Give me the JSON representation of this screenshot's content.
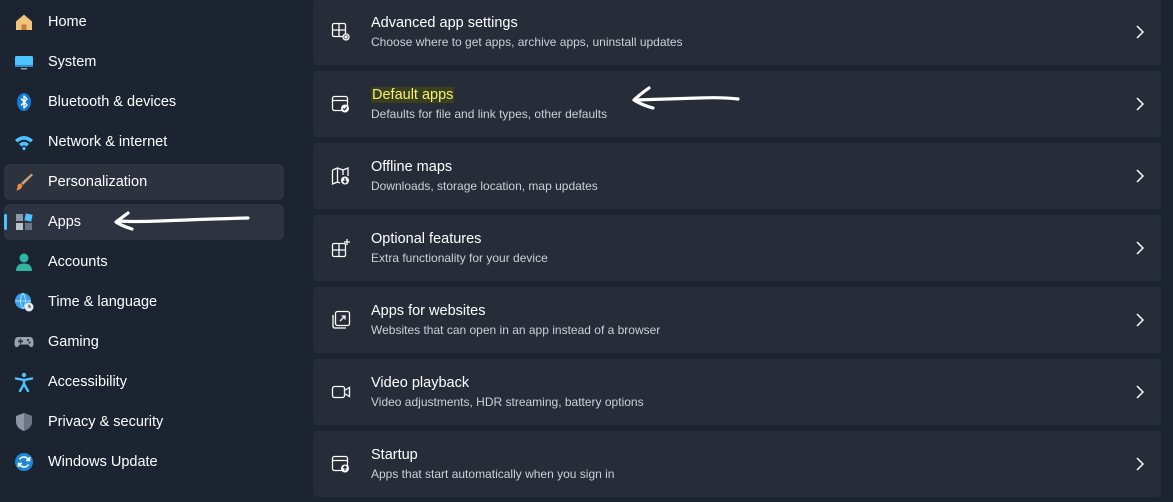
{
  "sidebar": {
    "items": [
      {
        "label": "Home",
        "icon": "home-icon"
      },
      {
        "label": "System",
        "icon": "system-icon"
      },
      {
        "label": "Bluetooth & devices",
        "icon": "bluetooth-icon"
      },
      {
        "label": "Network & internet",
        "icon": "wifi-icon"
      },
      {
        "label": "Personalization",
        "icon": "brush-icon"
      },
      {
        "label": "Apps",
        "icon": "apps-icon"
      },
      {
        "label": "Accounts",
        "icon": "account-icon"
      },
      {
        "label": "Time & language",
        "icon": "globe-clock-icon"
      },
      {
        "label": "Gaming",
        "icon": "gamepad-icon"
      },
      {
        "label": "Accessibility",
        "icon": "accessibility-icon"
      },
      {
        "label": "Privacy & security",
        "icon": "shield-icon"
      },
      {
        "label": "Windows Update",
        "icon": "update-icon"
      }
    ],
    "selected": "Apps",
    "hovered": "Personalization"
  },
  "main": {
    "cards": [
      {
        "title": "Advanced app settings",
        "subtitle": "Choose where to get apps, archive apps, uninstall updates",
        "icon": "app-settings-icon"
      },
      {
        "title": "Default apps",
        "subtitle": "Defaults for file and link types, other defaults",
        "icon": "default-apps-icon"
      },
      {
        "title": "Offline maps",
        "subtitle": "Downloads, storage location, map updates",
        "icon": "offline-maps-icon"
      },
      {
        "title": "Optional features",
        "subtitle": "Extra functionality for your device",
        "icon": "optional-features-icon"
      },
      {
        "title": "Apps for websites",
        "subtitle": "Websites that can open in an app instead of a browser",
        "icon": "apps-for-websites-icon"
      },
      {
        "title": "Video playback",
        "subtitle": "Video adjustments, HDR streaming, battery options",
        "icon": "video-icon"
      },
      {
        "title": "Startup",
        "subtitle": "Apps that start automatically when you sign in",
        "icon": "startup-icon"
      }
    ]
  },
  "colors": {
    "background": "#1c2331",
    "card": "#262c38",
    "accent": "#4cc2ff",
    "highlight_text": "#f4f07a"
  }
}
